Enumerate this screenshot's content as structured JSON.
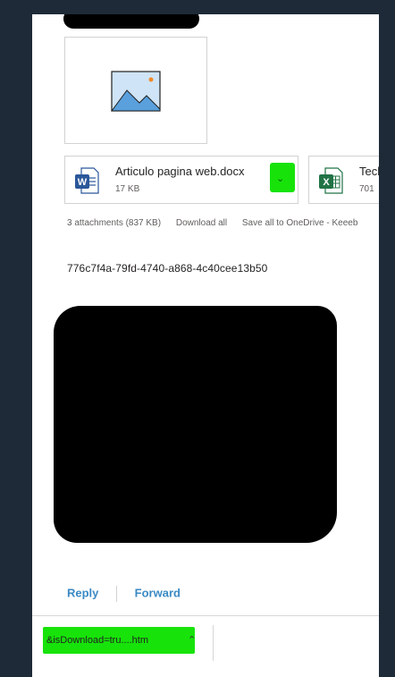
{
  "attachments": {
    "files": [
      {
        "name": "Articulo pagina web.docx",
        "size": "17 KB",
        "icon": "word-icon"
      },
      {
        "name": "Tech",
        "size": "701",
        "icon": "excel-icon"
      }
    ],
    "summary": "3 attachments (837 KB)",
    "download_all": "Download all",
    "save_all": "Save all to OneDrive - Keeeb"
  },
  "message": {
    "guid": "776c7f4a-79fd-4740-a868-4c40cee13b50"
  },
  "actions": {
    "reply": "Reply",
    "forward": "Forward"
  },
  "downloads": {
    "item": "&isDownload=tru....htm"
  },
  "colors": {
    "word_blue": "#2b579a",
    "excel_green": "#217346",
    "highlight_green": "#17e30a",
    "link_blue": "#3b8ac4"
  }
}
